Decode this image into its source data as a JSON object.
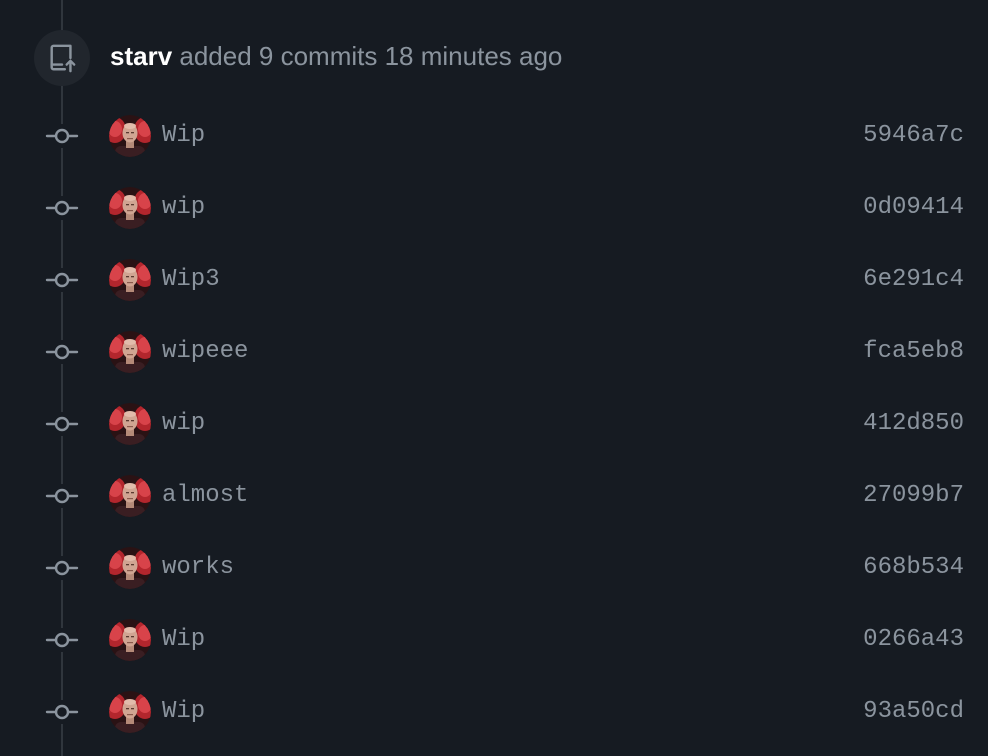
{
  "event": {
    "author": "starv",
    "action": "added 9 commits 18 minutes ago",
    "icon": "repo-push-icon"
  },
  "commits": [
    {
      "message": "Wip",
      "sha": "5946a7c"
    },
    {
      "message": "wip",
      "sha": "0d09414"
    },
    {
      "message": "Wip3",
      "sha": "6e291c4"
    },
    {
      "message": "wipeee",
      "sha": "fca5eb8"
    },
    {
      "message": "wip",
      "sha": "412d850"
    },
    {
      "message": "almost",
      "sha": "27099b7"
    },
    {
      "message": "works",
      "sha": "668b534"
    },
    {
      "message": "Wip",
      "sha": "0266a43"
    },
    {
      "message": "Wip",
      "sha": "93a50cd"
    }
  ],
  "colors": {
    "background": "#161b22",
    "text_muted": "#8b949e",
    "text_strong": "#ffffff",
    "timeline": "#30363d"
  }
}
